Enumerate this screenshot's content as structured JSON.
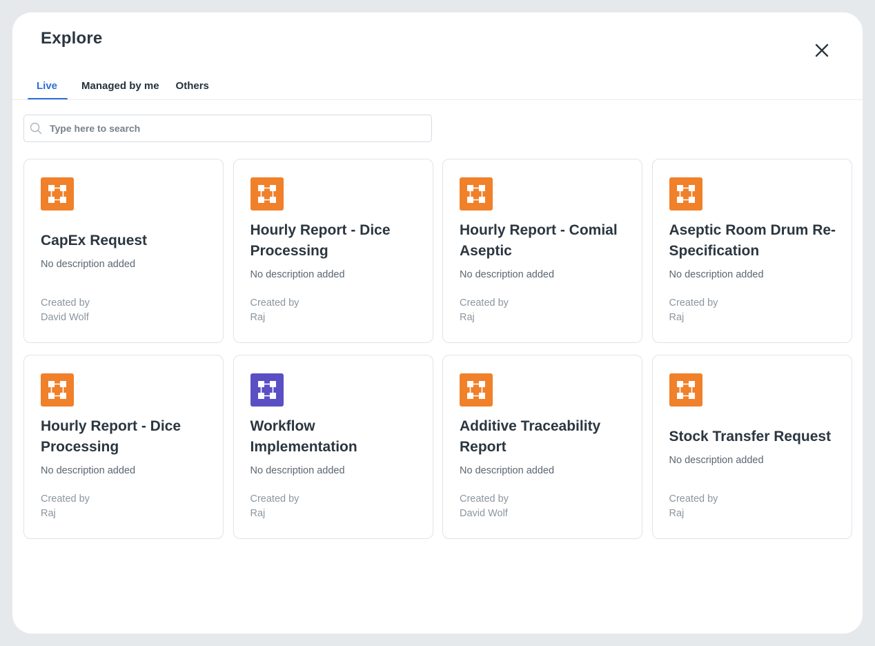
{
  "header": {
    "title": "Explore"
  },
  "tabs": [
    {
      "label": "Live",
      "active": true
    },
    {
      "label": "Managed by me",
      "active": false
    },
    {
      "label": "Others",
      "active": false
    }
  ],
  "search": {
    "placeholder": "Type here to search",
    "value": ""
  },
  "colors": {
    "accent": "#2a6fd6",
    "icon_orange": "#f0802a",
    "icon_purple": "#5b4fc4"
  },
  "cards": [
    {
      "title": "CapEx Request",
      "description": "No description added",
      "created_label": "Created by",
      "created_by": "David Wolf",
      "icon": "workflow-icon",
      "icon_color": "#f0802a"
    },
    {
      "title": "Hourly Report - Dice Processing",
      "description": "No description added",
      "created_label": "Created by",
      "created_by": "Raj",
      "icon": "workflow-icon",
      "icon_color": "#f0802a"
    },
    {
      "title": "Hourly Report - Comial Aseptic",
      "description": "No description added",
      "created_label": "Created by",
      "created_by": "Raj",
      "icon": "workflow-icon",
      "icon_color": "#f0802a"
    },
    {
      "title": "Aseptic Room Drum Re-Specification",
      "description": "No description added",
      "created_label": "Created by",
      "created_by": "Raj",
      "icon": "workflow-icon",
      "icon_color": "#f0802a"
    },
    {
      "title": "Hourly Report - Dice Processing",
      "description": "No description added",
      "created_label": "Created by",
      "created_by": "Raj",
      "icon": "workflow-icon",
      "icon_color": "#f0802a"
    },
    {
      "title": "Workflow Implementation",
      "description": "No description added",
      "created_label": "Created by",
      "created_by": "Raj",
      "icon": "workflow-icon",
      "icon_color": "#5b4fc4"
    },
    {
      "title": "Additive Traceability Report",
      "description": "No description added",
      "created_label": "Created by",
      "created_by": "David Wolf",
      "icon": "workflow-icon",
      "icon_color": "#f0802a"
    },
    {
      "title": "Stock Transfer Request",
      "description": "No description added",
      "created_label": "Created by",
      "created_by": "Raj",
      "icon": "workflow-icon",
      "icon_color": "#f0802a"
    }
  ]
}
